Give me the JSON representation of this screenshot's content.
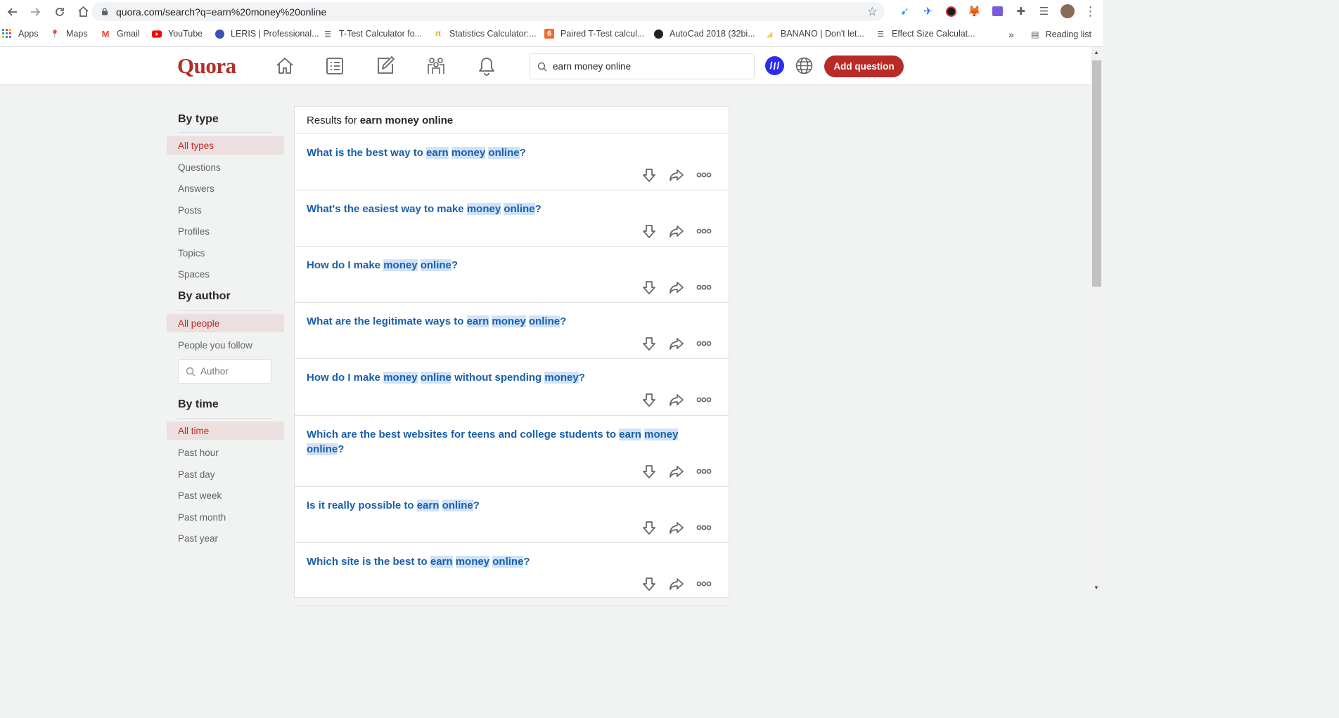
{
  "browser": {
    "url": "quora.com/search?q=earn%20money%20online",
    "bookmarks": [
      {
        "label": "Apps",
        "icon": "apps-grid-icon"
      },
      {
        "label": "Maps",
        "icon": "maps-pin-icon"
      },
      {
        "label": "Gmail",
        "icon": "gmail-icon"
      },
      {
        "label": "YouTube",
        "icon": "youtube-icon"
      },
      {
        "label": "LERIS | Professional...",
        "icon": "leris-icon"
      },
      {
        "label": "T-Test Calculator fo...",
        "icon": "page-list-icon"
      },
      {
        "label": "Statistics Calculator:...",
        "icon": "pi-icon"
      },
      {
        "label": "Paired T-Test calcul...",
        "icon": "six-icon"
      },
      {
        "label": "AutoCad 2018 (32bi...",
        "icon": "autocad-icon"
      },
      {
        "label": "BANANO | Don't let...",
        "icon": "banano-icon"
      },
      {
        "label": "Effect Size Calculat...",
        "icon": "page-list-icon"
      }
    ],
    "overflow": "»",
    "reading_list": "Reading list"
  },
  "header": {
    "logo": "Quora",
    "search_value": "earn money online",
    "add_question": "Add question",
    "brand_color": "#b92b27"
  },
  "sidebar": {
    "by_type": {
      "heading": "By type",
      "items": [
        "All types",
        "Questions",
        "Answers",
        "Posts",
        "Profiles",
        "Topics",
        "Spaces"
      ],
      "active": "All types"
    },
    "by_author": {
      "heading": "By author",
      "items": [
        "All people",
        "People you follow"
      ],
      "active": "All people",
      "author_placeholder": "Author"
    },
    "by_time": {
      "heading": "By time",
      "items": [
        "All time",
        "Past hour",
        "Past day",
        "Past week",
        "Past month",
        "Past year"
      ],
      "active": "All time"
    }
  },
  "results": {
    "prefix": "Results for",
    "query": "earn money online",
    "items": [
      {
        "segments": [
          [
            "What is the best way to ",
            false
          ],
          [
            "earn",
            true
          ],
          [
            " ",
            false
          ],
          [
            "money",
            true
          ],
          [
            " ",
            false
          ],
          [
            "online",
            true
          ],
          [
            "?",
            false
          ]
        ]
      },
      {
        "segments": [
          [
            "What's the easiest way to make ",
            false
          ],
          [
            "money",
            true
          ],
          [
            " ",
            false
          ],
          [
            "online",
            true
          ],
          [
            "?",
            false
          ]
        ]
      },
      {
        "segments": [
          [
            "How do I make ",
            false
          ],
          [
            "money",
            true
          ],
          [
            " ",
            false
          ],
          [
            "online",
            true
          ],
          [
            "?",
            false
          ]
        ]
      },
      {
        "segments": [
          [
            "What are the legitimate ways to ",
            false
          ],
          [
            "earn",
            true
          ],
          [
            " ",
            false
          ],
          [
            "money",
            true
          ],
          [
            " ",
            false
          ],
          [
            "online",
            true
          ],
          [
            "?",
            false
          ]
        ]
      },
      {
        "segments": [
          [
            "How do I make ",
            false
          ],
          [
            "money",
            true
          ],
          [
            " ",
            false
          ],
          [
            "online",
            true
          ],
          [
            " without spending ",
            false
          ],
          [
            "money",
            true
          ],
          [
            "?",
            false
          ]
        ]
      },
      {
        "segments": [
          [
            "Which are the best websites for teens and college students to ",
            false
          ],
          [
            "earn",
            true
          ],
          [
            " ",
            false
          ],
          [
            "money",
            true
          ],
          [
            " ",
            false
          ],
          [
            "online",
            true
          ],
          [
            "?",
            false
          ]
        ]
      },
      {
        "segments": [
          [
            "Is it really possible to ",
            false
          ],
          [
            "earn",
            true
          ],
          [
            " ",
            false
          ],
          [
            "online",
            true
          ],
          [
            "?",
            false
          ]
        ]
      },
      {
        "segments": [
          [
            "Which site is the best to ",
            false
          ],
          [
            "earn",
            true
          ],
          [
            " ",
            false
          ],
          [
            "money",
            true
          ],
          [
            " ",
            false
          ],
          [
            "online",
            true
          ],
          [
            "?",
            false
          ]
        ]
      }
    ]
  }
}
